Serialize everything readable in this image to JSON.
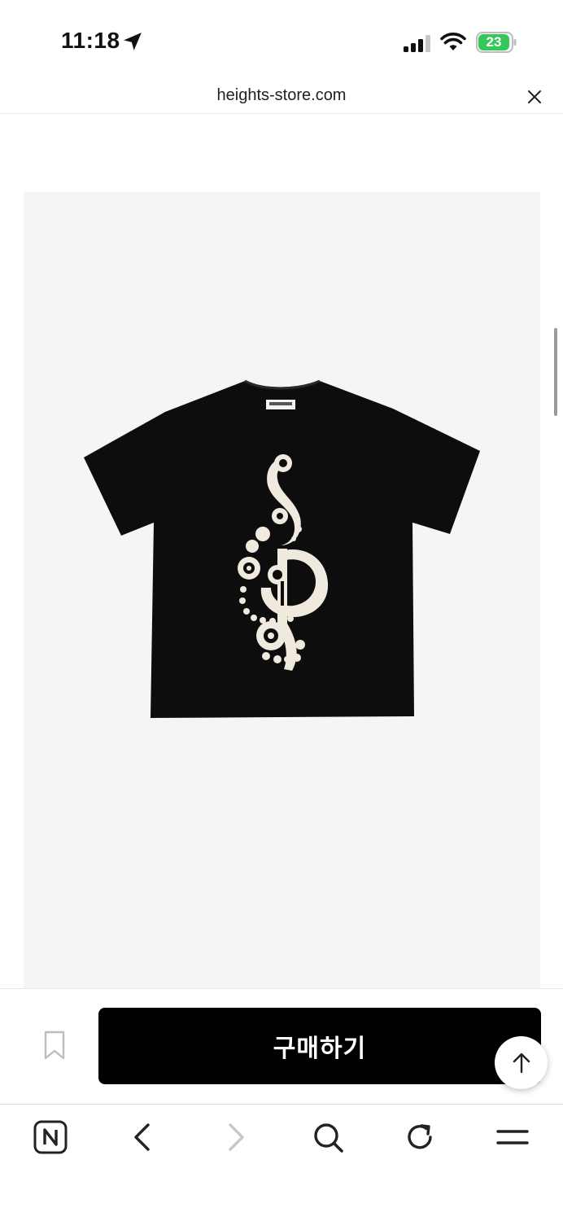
{
  "status_bar": {
    "time": "11:18",
    "battery": "23",
    "icons": [
      "location-arrow-icon",
      "cellular-signal-icon",
      "wifi-icon",
      "battery-charging-icon"
    ]
  },
  "url_bar": {
    "url": "heights-store.com"
  },
  "product": {
    "image": "black-tshirt-treble-clef-print",
    "colors": {
      "shirt": "#0d0d0d",
      "print": "#efe9de",
      "background": "#f5f5f5"
    }
  },
  "purchase": {
    "buy_label": "구매하기",
    "colors": {
      "button": "#000000",
      "label": "#ffffff"
    }
  },
  "toolbar": {
    "icons": [
      "naver-home-icon",
      "back-icon",
      "forward-icon",
      "search-icon",
      "reload-icon",
      "menu-icon"
    ]
  }
}
